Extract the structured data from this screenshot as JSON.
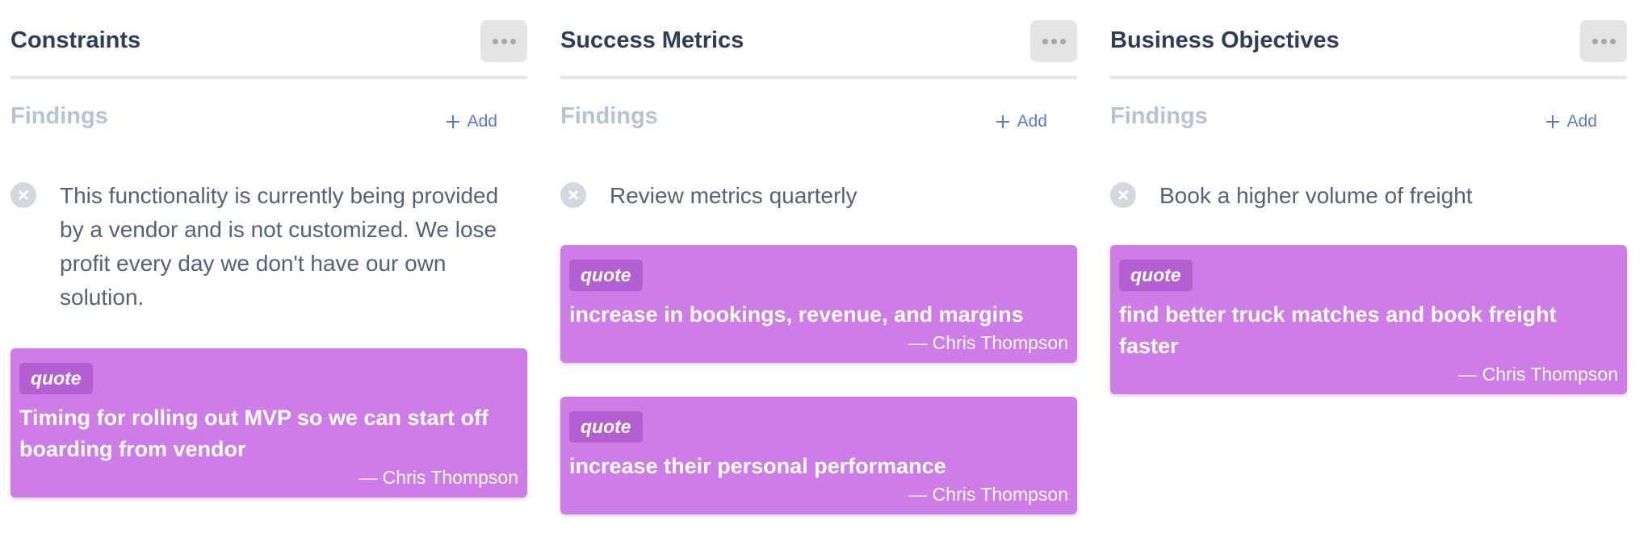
{
  "columns": [
    {
      "title": "Constraints",
      "section_title": "Findings",
      "add_label": "Add",
      "finding": "This functionality is currently being provided by a vendor and is not customized. We lose profit every day we don't have our own solution.",
      "quotes": [
        {
          "badge": "quote",
          "text": "Timing for rolling out MVP so we can start off boarding from vendor",
          "author": "— Chris Thompson"
        }
      ]
    },
    {
      "title": "Success Metrics",
      "section_title": "Findings",
      "add_label": "Add",
      "finding": "Review metrics quarterly",
      "quotes": [
        {
          "badge": "quote",
          "text": "increase in bookings, revenue, and margins",
          "author": "— Chris Thompson"
        },
        {
          "badge": "quote",
          "text": "increase their personal performance",
          "author": "— Chris Thompson"
        }
      ]
    },
    {
      "title": "Business Objectives",
      "section_title": "Findings",
      "add_label": "Add",
      "finding": "Book a higher volume of freight",
      "quotes": [
        {
          "badge": "quote",
          "text": "find better truck matches and book freight faster",
          "author": "— Chris Thompson"
        }
      ]
    }
  ],
  "icons": {
    "more": "more-horizontal-icon",
    "add": "plus-icon",
    "remove": "close-circle-icon"
  },
  "colors": {
    "title": "#2f3d5c",
    "section": "#b7c3d4",
    "accent": "#5a77d6",
    "quote_card": "#cd7ce8",
    "quote_badge": "#b45fd1",
    "divider": "#dde7ef"
  }
}
